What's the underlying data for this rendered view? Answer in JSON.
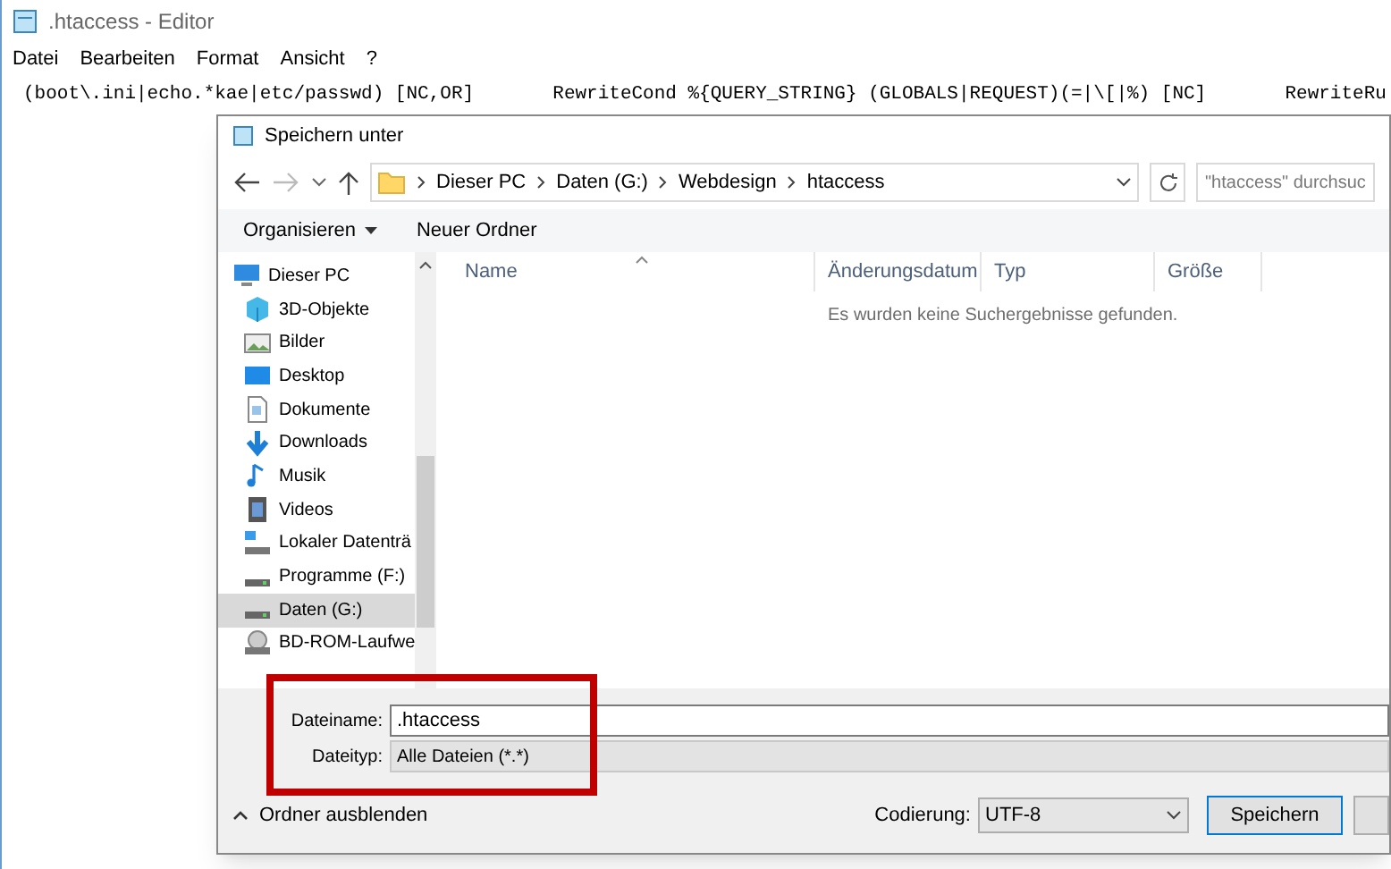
{
  "editor": {
    "title": ".htaccess - Editor",
    "menu": [
      "Datei",
      "Bearbeiten",
      "Format",
      "Ansicht",
      "?"
    ],
    "text": "(boot\\.ini|echo.*kae|etc/passwd) [NC,OR]       RewriteCond %{QUERY_STRING} (GLOBALS|REQUEST)(=|\\[|%) [NC]       RewriteRu"
  },
  "dialog": {
    "title": "Speichern unter",
    "breadcrumb": [
      "Dieser PC",
      "Daten (G:)",
      "Webdesign",
      "htaccess"
    ],
    "search": {
      "placeholder": "\"htaccess\" durchsuc"
    },
    "toolbar": [
      {
        "label": "Organisieren",
        "dropdown": true
      },
      {
        "label": "Neuer Ordner",
        "dropdown": false
      }
    ],
    "sidebar": {
      "items": [
        {
          "label": "Dieser PC",
          "kind": "pc",
          "selected": false
        },
        {
          "label": "3D-Objekte",
          "kind": "cube",
          "selected": false
        },
        {
          "label": "Bilder",
          "kind": "picture",
          "selected": false
        },
        {
          "label": "Desktop",
          "kind": "desktop",
          "selected": false
        },
        {
          "label": "Dokumente",
          "kind": "document",
          "selected": false
        },
        {
          "label": "Downloads",
          "kind": "download",
          "selected": false
        },
        {
          "label": "Musik",
          "kind": "music",
          "selected": false
        },
        {
          "label": "Videos",
          "kind": "video",
          "selected": false
        },
        {
          "label": "Lokaler Datenträ",
          "kind": "windrive",
          "selected": false
        },
        {
          "label": "Programme (F:)",
          "kind": "drive",
          "selected": false
        },
        {
          "label": "Daten (G:)",
          "kind": "drive",
          "selected": true
        },
        {
          "label": "BD-ROM-Laufwe",
          "kind": "disc",
          "selected": false
        }
      ]
    },
    "columns": [
      "Name",
      "Änderungsdatum",
      "Typ",
      "Größe"
    ],
    "empty_message": "Es wurden keine Suchergebnisse gefunden.",
    "filename": {
      "label": "Dateiname:",
      "value": ".htaccess"
    },
    "filetype": {
      "label": "Dateityp:",
      "value": "Alle Dateien  (*.*)"
    },
    "hide_folders": "Ordner ausblenden",
    "encoding": {
      "label": "Codierung:",
      "value": "UTF-8"
    },
    "save_button": "Speichern"
  }
}
